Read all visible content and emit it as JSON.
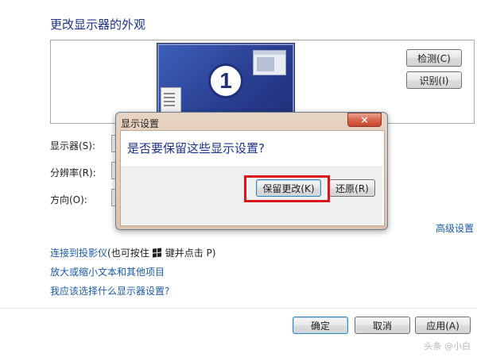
{
  "page": {
    "title": "更改显示器的外观"
  },
  "preview": {
    "monitor_number": "1",
    "detect_button": "检测(C)",
    "identify_button": "识别(I)"
  },
  "form": {
    "display_label": "显示器(S):",
    "resolution_label": "分辨率(R):",
    "orientation_label": "方向(O):"
  },
  "links": {
    "advanced": "高级设置",
    "projector_link": "连接到投影仪",
    "projector_hint_pre": "(也可按住",
    "projector_hint_post": "键并点击 P)",
    "text_size": "放大或缩小文本和其他项目",
    "help": "我应该选择什么显示器设置?"
  },
  "dialog": {
    "title": "显示设置",
    "close_glyph": "×",
    "question": "是否要保留这些显示设置?",
    "keep_button": "保留更改(K)",
    "revert_button": "还原(R)"
  },
  "footer": {
    "ok_button": "确定",
    "cancel_button": "取消",
    "apply_button": "应用(A)"
  },
  "watermark": "头条 @小白"
}
